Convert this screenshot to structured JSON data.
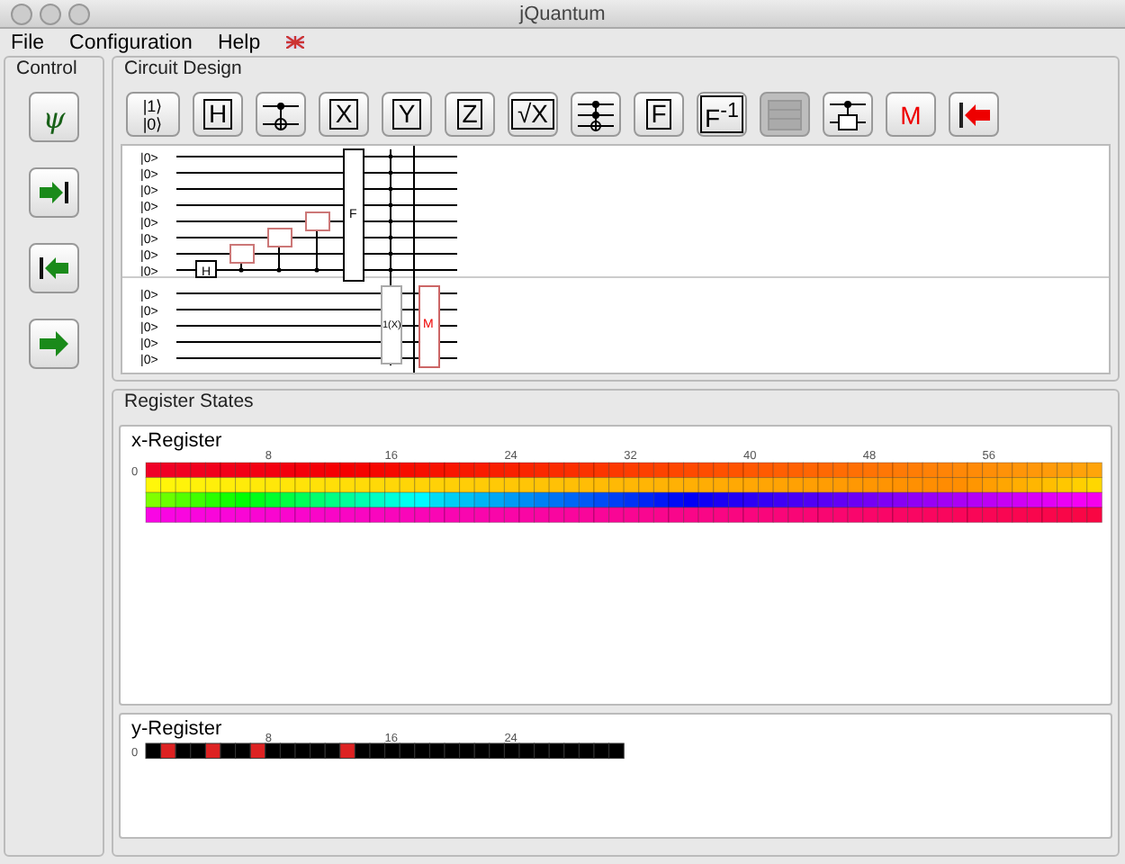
{
  "window": {
    "title": "jQuantum"
  },
  "menu": [
    "File",
    "Configuration",
    "Help"
  ],
  "control": {
    "title": "Control",
    "buttons": [
      {
        "kind": "psi",
        "label": "ψ"
      },
      {
        "kind": "step-forward"
      },
      {
        "kind": "step-back"
      },
      {
        "kind": "run"
      }
    ]
  },
  "circuit": {
    "title": "Circuit Design",
    "toolbar": [
      {
        "kind": "init",
        "label": "|1⟩",
        "label2": "|0⟩",
        "disabled": false
      },
      {
        "kind": "gate",
        "label": "H",
        "disabled": false
      },
      {
        "kind": "cnot",
        "disabled": false
      },
      {
        "kind": "gate",
        "label": "X",
        "disabled": false
      },
      {
        "kind": "gate",
        "label": "Y",
        "disabled": false
      },
      {
        "kind": "gate",
        "label": "Z",
        "disabled": false
      },
      {
        "kind": "gate",
        "label": "√X",
        "disabled": false
      },
      {
        "kind": "toffoli",
        "disabled": false
      },
      {
        "kind": "gate",
        "label": "F",
        "disabled": false
      },
      {
        "kind": "gate",
        "label": "F$^{-1}$",
        "disabled": false
      },
      {
        "kind": "grid",
        "disabled": true
      },
      {
        "kind": "phase",
        "disabled": false
      },
      {
        "kind": "measure",
        "label": "M",
        "disabled": false
      },
      {
        "kind": "reset",
        "disabled": false
      }
    ],
    "x_wires": [
      "|0>",
      "|0>",
      "|0>",
      "|0>",
      "|0>",
      "|0>",
      "|0>",
      "|0>"
    ],
    "y_wires": [
      "|0>",
      "|0>",
      "|0>",
      "|0>",
      "|0>"
    ],
    "gates": {
      "hadamard": "H",
      "fourier": "F",
      "function": "1(X)",
      "measure": "M"
    }
  },
  "registers": {
    "title": "Register States",
    "x_register": {
      "title": "x-Register",
      "ticks": [
        "0",
        "8",
        "16",
        "24",
        "32",
        "40",
        "48",
        "56"
      ]
    },
    "y_register": {
      "title": "y-Register",
      "ticks": [
        "0",
        "8",
        "16",
        "24"
      ],
      "cells": [
        {
          "on": false
        },
        {
          "on": true
        },
        {
          "on": false
        },
        {
          "on": false
        },
        {
          "on": true
        },
        {
          "on": false
        },
        {
          "on": false
        },
        {
          "on": true
        },
        {
          "on": false
        },
        {
          "on": false
        },
        {
          "on": false
        },
        {
          "on": false
        },
        {
          "on": false
        },
        {
          "on": true
        },
        {
          "on": false
        },
        {
          "on": false
        },
        {
          "on": false
        },
        {
          "on": false
        },
        {
          "on": false
        },
        {
          "on": false
        },
        {
          "on": false
        },
        {
          "on": false
        },
        {
          "on": false
        },
        {
          "on": false
        },
        {
          "on": false
        },
        {
          "on": false
        },
        {
          "on": false
        },
        {
          "on": false
        },
        {
          "on": false
        },
        {
          "on": false
        },
        {
          "on": false
        },
        {
          "on": false
        }
      ]
    }
  }
}
